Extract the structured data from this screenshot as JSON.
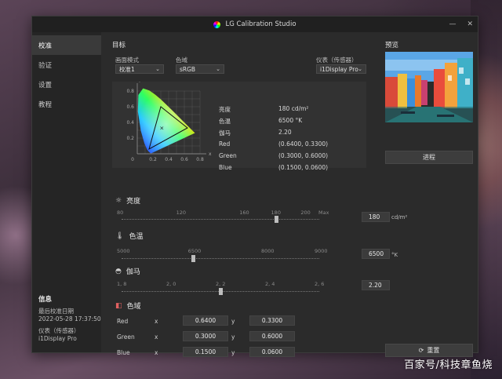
{
  "window": {
    "title": "LG Calibration Studio"
  },
  "sidebar": {
    "items": [
      {
        "label": "校准",
        "active": true
      },
      {
        "label": "验证",
        "active": false
      },
      {
        "label": "设置",
        "active": false
      },
      {
        "label": "教程",
        "active": false
      }
    ],
    "info": {
      "heading": "信息",
      "last_cal_label": "最后校准日期",
      "last_cal_value": "2022-05-28 17:37:50",
      "instrument_label": "仪表（传感器）",
      "instrument_value": "i1Display Pro"
    }
  },
  "target": {
    "heading": "目标",
    "mode_label": "画面模式",
    "mode_value": "校准1",
    "gamut_label": "色域",
    "gamut_value": "sRGB",
    "instrument_label": "仪表（传感器）",
    "instrument_value": "i1Display Pro"
  },
  "chart": {
    "y_axis": "y",
    "x_axis": "x",
    "y_ticks": [
      "0.8",
      "0.6",
      "0.4",
      "0.2",
      "0"
    ],
    "x_ticks": [
      "0.2",
      "0.4",
      "0.6",
      "0.8"
    ],
    "origin": "0",
    "gamut_points": [
      [
        0.64,
        0.33
      ],
      [
        0.3,
        0.6
      ],
      [
        0.15,
        0.06
      ]
    ],
    "white_point": [
      0.3127,
      0.329
    ]
  },
  "stats": [
    {
      "label": "亮度",
      "value": "180 cd/m²"
    },
    {
      "label": "色温",
      "value": "6500 °K"
    },
    {
      "label": "伽马",
      "value": "2.20"
    },
    {
      "label": "Red",
      "value": "(0.6400, 0.3300)"
    },
    {
      "label": "Green",
      "value": "(0.3000, 0.6000)"
    },
    {
      "label": "Blue",
      "value": "(0.1500, 0.0600)"
    }
  ],
  "brightness": {
    "label": "亮度",
    "ticks": [
      "80",
      "120",
      "160",
      "180",
      "200",
      "Max"
    ],
    "value": "180",
    "unit": "cd/m²",
    "level": 0.78
  },
  "color_temp": {
    "label": "色温",
    "ticks": [
      "5000",
      "6500",
      "8000",
      "9000"
    ],
    "value": "6500",
    "unit": "°K",
    "level": 0.36
  },
  "gamma": {
    "label": "伽马",
    "ticks": [
      "1, 8",
      "2, 0",
      "2, 2",
      "2, 4",
      "2, 6"
    ],
    "value": "2.20",
    "level": 0.5
  },
  "gamut": {
    "label": "色域",
    "rows": [
      {
        "name": "Red",
        "x_label": "x",
        "x": "0.6400",
        "y_label": "y",
        "y": "0.3300"
      },
      {
        "name": "Green",
        "x_label": "x",
        "x": "0.3000",
        "y_label": "y",
        "y": "0.6000"
      },
      {
        "name": "Blue",
        "x_label": "x",
        "x": "0.1500",
        "y_label": "y",
        "y": "0.0600"
      }
    ]
  },
  "preview": {
    "heading": "预览",
    "progress_label": "进程",
    "reset_label": "重置"
  },
  "watermark": "百家号/科技章鱼烧"
}
